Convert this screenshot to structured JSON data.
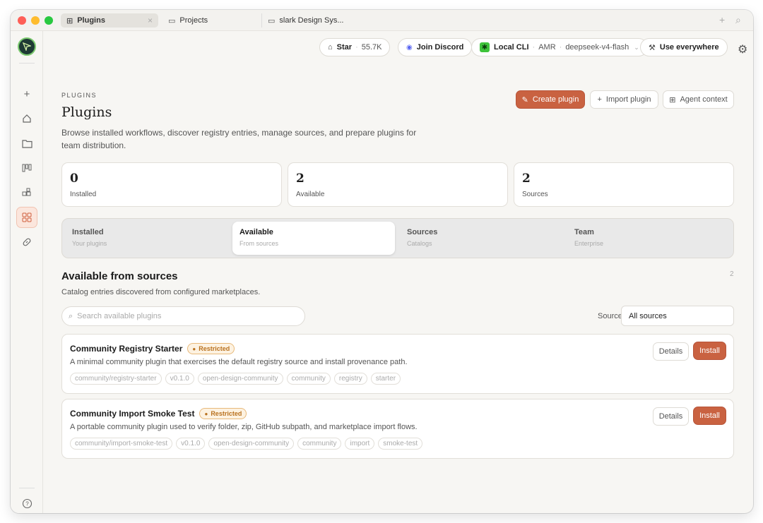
{
  "titlebar": {
    "tabs": [
      {
        "label": "Plugins",
        "icon": "grid-icon"
      },
      {
        "label": "Projects",
        "icon": "folder-icon"
      },
      {
        "label": "slark Design Sys...",
        "icon": "folder-icon"
      }
    ],
    "close": "×",
    "plus": "+",
    "search": "⌕"
  },
  "topbar": {
    "star_label": "Star",
    "star_count": "55.7K",
    "discord_label": "Join Discord",
    "cli_label": "Local CLI",
    "cli_region": "AMR",
    "cli_model": "deepseek-v4-flash",
    "use_everywhere": "Use everywhere"
  },
  "page": {
    "eyebrow": "PLUGINS",
    "title": "Plugins",
    "subtitle": "Browse installed workflows, discover registry entries, manage sources, and prepare plugins for team distribution.",
    "actions": {
      "create": "Create plugin",
      "import": "Import plugin",
      "agent": "Agent context"
    }
  },
  "stats": [
    {
      "value": "0",
      "label": "Installed"
    },
    {
      "value": "2",
      "label": "Available"
    },
    {
      "value": "2",
      "label": "Sources"
    }
  ],
  "tabs": [
    {
      "title": "Installed",
      "sub": "Your plugins"
    },
    {
      "title": "Available",
      "sub": "From sources"
    },
    {
      "title": "Sources",
      "sub": "Catalogs"
    },
    {
      "title": "Team",
      "sub": "Enterprise"
    }
  ],
  "section": {
    "title": "Available from sources",
    "count": "2",
    "subtitle": "Catalog entries discovered from configured marketplaces.",
    "search_placeholder": "Search available plugins",
    "source_label": "Source",
    "source_value": "All sources"
  },
  "plugins": [
    {
      "name": "Community Registry Starter",
      "badge": "Restricted",
      "desc": "A minimal community plugin that exercises the default registry source and install provenance path.",
      "tags": [
        "community/registry-starter",
        "v0.1.0",
        "open-design-community",
        "community",
        "registry",
        "starter"
      ],
      "details": "Details",
      "install": "Install"
    },
    {
      "name": "Community Import Smoke Test",
      "badge": "Restricted",
      "desc": "A portable community plugin used to verify folder, zip, GitHub subpath, and marketplace import flows.",
      "tags": [
        "community/import-smoke-test",
        "v0.1.0",
        "open-design-community",
        "community",
        "import",
        "smoke-test"
      ],
      "details": "Details",
      "install": "Install"
    }
  ],
  "colors": {
    "accent": "#c96241",
    "badge": "#b9711e",
    "background": "#f7f6f3"
  }
}
